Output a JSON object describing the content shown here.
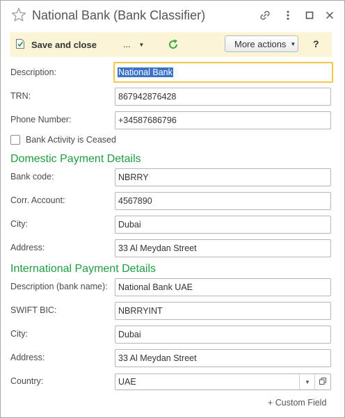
{
  "window": {
    "title": "National Bank (Bank Classifier)"
  },
  "toolbar": {
    "save_close_label": "Save and close",
    "dots_label": "...",
    "more_actions_label": "More actions",
    "help_label": "?"
  },
  "fields": {
    "description": {
      "label": "Description:",
      "value": "National Bank"
    },
    "trn": {
      "label": "TRN:",
      "value": "867942876428"
    },
    "phone": {
      "label": "Phone Number:",
      "value": "+34587686796"
    },
    "activity_ceased": {
      "label": "Bank Activity is Ceased",
      "checked": false
    }
  },
  "domestic": {
    "heading": "Domestic Payment Details",
    "bank_code": {
      "label": "Bank code:",
      "value": "NBRRY"
    },
    "corr_account": {
      "label": "Corr. Account:",
      "value": "4567890"
    },
    "city": {
      "label": "City:",
      "value": "Dubai"
    },
    "address": {
      "label": "Address:",
      "value": "33 Al Meydan Street"
    }
  },
  "international": {
    "heading": "International Payment Details",
    "bank_name": {
      "label": "Description (bank name):",
      "value": "National Bank UAE"
    },
    "swift": {
      "label": "SWIFT BIC:",
      "value": "NBRRYINT"
    },
    "city": {
      "label": "City:",
      "value": "Dubai"
    },
    "address": {
      "label": "Address:",
      "value": "33 Al Meydan Street"
    },
    "country": {
      "label": "Country:",
      "value": "UAE"
    }
  },
  "footer": {
    "custom_field_label": "+ Custom Field"
  },
  "colors": {
    "section_heading": "#1e9c3f",
    "command_bar_bg": "#fbf5d7",
    "focus_border": "#f4c842",
    "selection_bg": "#3b73c9",
    "refresh_icon": "#3aa93a"
  }
}
